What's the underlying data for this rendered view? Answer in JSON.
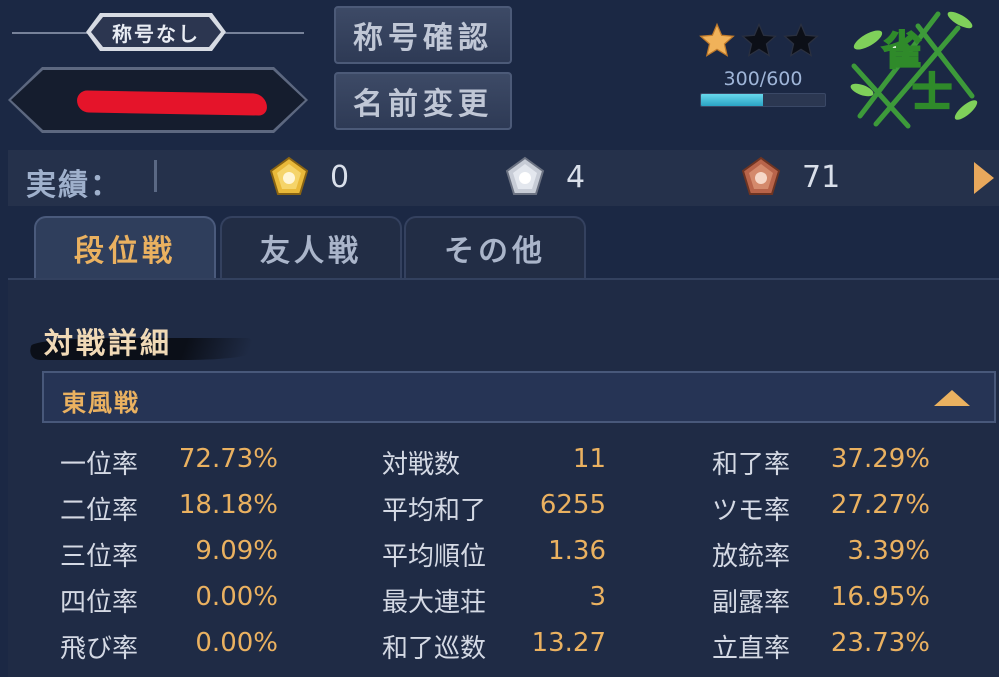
{
  "header": {
    "title_tag": "称号なし",
    "buttons": {
      "title_check": "称号確認",
      "name_change": "名前変更"
    },
    "stars": {
      "filled": 1,
      "total": 3
    },
    "exp": {
      "text": "300/600",
      "current": 300,
      "max": 600
    },
    "rank_emblem": "雀士"
  },
  "achievements": {
    "label": "実績：",
    "gold": "0",
    "silver": "4",
    "bronze": "71"
  },
  "tabs": [
    {
      "label": "段位戦",
      "active": true
    },
    {
      "label": "友人戦",
      "active": false
    },
    {
      "label": "その他",
      "active": false
    }
  ],
  "details": {
    "section_title": "対戦詳細",
    "mode": "東風戦",
    "columns": [
      [
        {
          "label": "一位率",
          "value": "72.73%"
        },
        {
          "label": "二位率",
          "value": "18.18%"
        },
        {
          "label": "三位率",
          "value": "9.09%"
        },
        {
          "label": "四位率",
          "value": "0.00%"
        },
        {
          "label": "飛び率",
          "value": "0.00%"
        }
      ],
      [
        {
          "label": "対戦数",
          "value": "11"
        },
        {
          "label": "平均和了",
          "value": "6255"
        },
        {
          "label": "平均順位",
          "value": "1.36"
        },
        {
          "label": "最大連荘",
          "value": "3"
        },
        {
          "label": "和了巡数",
          "value": "13.27"
        }
      ],
      [
        {
          "label": "和了率",
          "value": "37.29%"
        },
        {
          "label": "ツモ率",
          "value": "27.27%"
        },
        {
          "label": "放銃率",
          "value": "3.39%"
        },
        {
          "label": "副露率",
          "value": "16.95%"
        },
        {
          "label": "立直率",
          "value": "23.73%"
        }
      ]
    ]
  },
  "colors": {
    "accent": "#eab160",
    "background": "#1b2844",
    "exp_fill": "#2aa3c4",
    "redaction": "#e5142a"
  }
}
